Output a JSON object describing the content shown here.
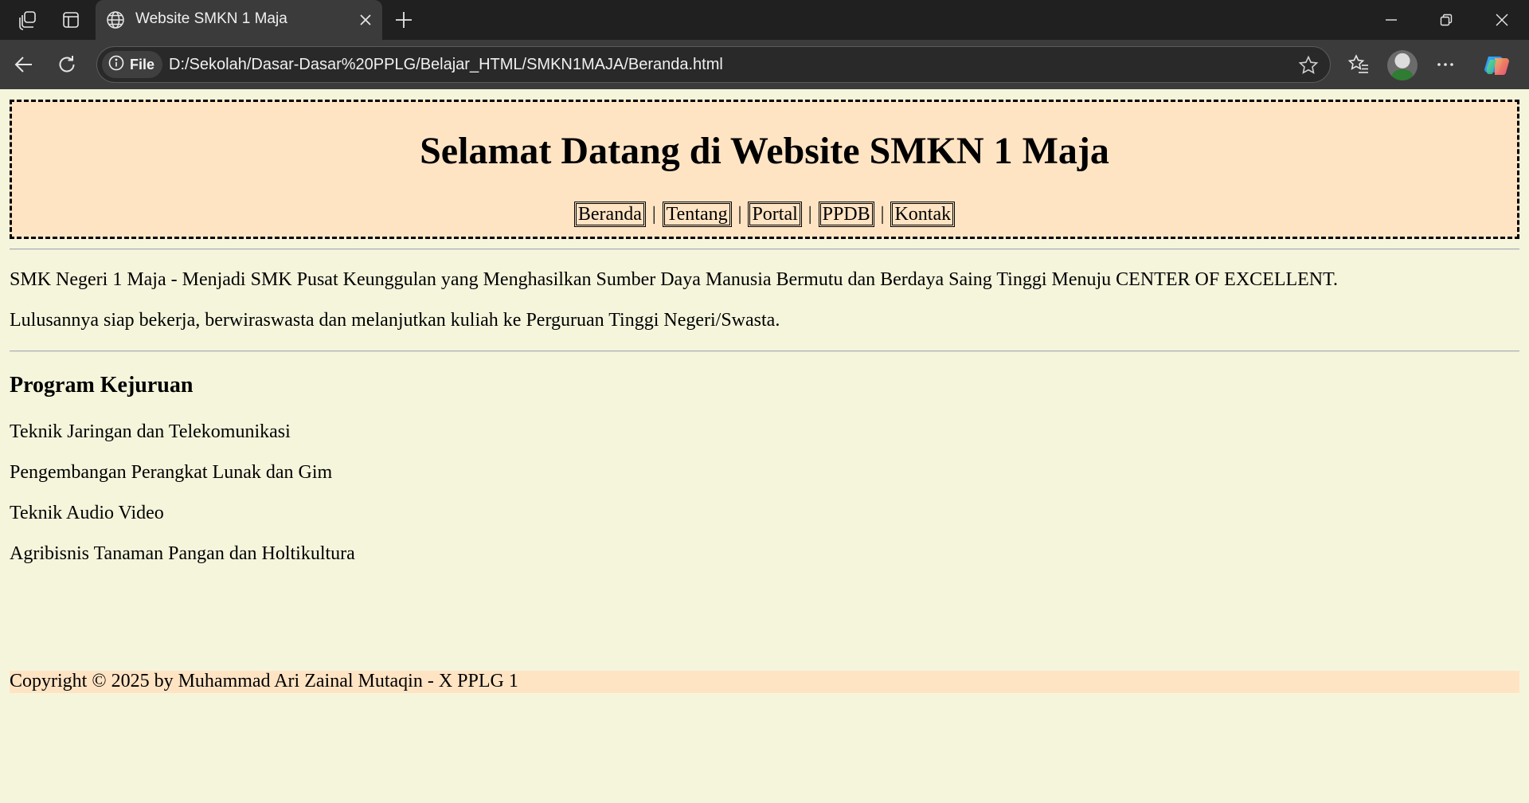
{
  "browser": {
    "tab_title": "Website SMKN 1 Maja",
    "site_info_label": "File",
    "url": "D:/Sekolah/Dasar-Dasar%20PPLG/Belajar_HTML/SMKN1MAJA/Beranda.html",
    "icons": [
      "workspaces-icon",
      "tab-actions-icon",
      "globe-icon",
      "close-icon",
      "plus-icon",
      "minimize-icon",
      "restore-icon",
      "window-close-icon",
      "back-icon",
      "refresh-icon",
      "info-icon",
      "star-icon",
      "favorites-icon",
      "avatar",
      "more-icon",
      "copilot-icon"
    ]
  },
  "page": {
    "title": "Selamat Datang di Website SMKN 1 Maja",
    "nav": [
      "Beranda",
      "Tentang",
      "Portal",
      "PPDB",
      "Kontak"
    ],
    "nav_separator": "|",
    "intro_1": "SMK Negeri 1 Maja - Menjadi SMK Pusat Keunggulan yang Menghasilkan Sumber Daya Manusia Bermutu dan Berdaya Saing Tinggi Menuju CENTER OF EXCELLENT.",
    "intro_2": "Lulusannya siap bekerja, berwiraswasta dan melanjutkan kuliah ke Perguruan Tinggi Negeri/Swasta.",
    "programs_heading": "Program Kejuruan",
    "programs": [
      "Teknik Jaringan dan Telekomunikasi",
      "Pengembangan Perangkat Lunak dan Gim",
      "Teknik Audio Video",
      "Agribisnis Tanaman Pangan dan Holtikultura"
    ],
    "footer": "Copyright © 2025 by Muhammad Ari Zainal Mutaqin - X PPLG 1"
  },
  "colors": {
    "page_background": "#f5f5dc",
    "header_background": "#ffe4c4",
    "footer_background": "#ffe4c4",
    "browser_chrome": "#202020",
    "toolbar": "#3b3b3b"
  }
}
